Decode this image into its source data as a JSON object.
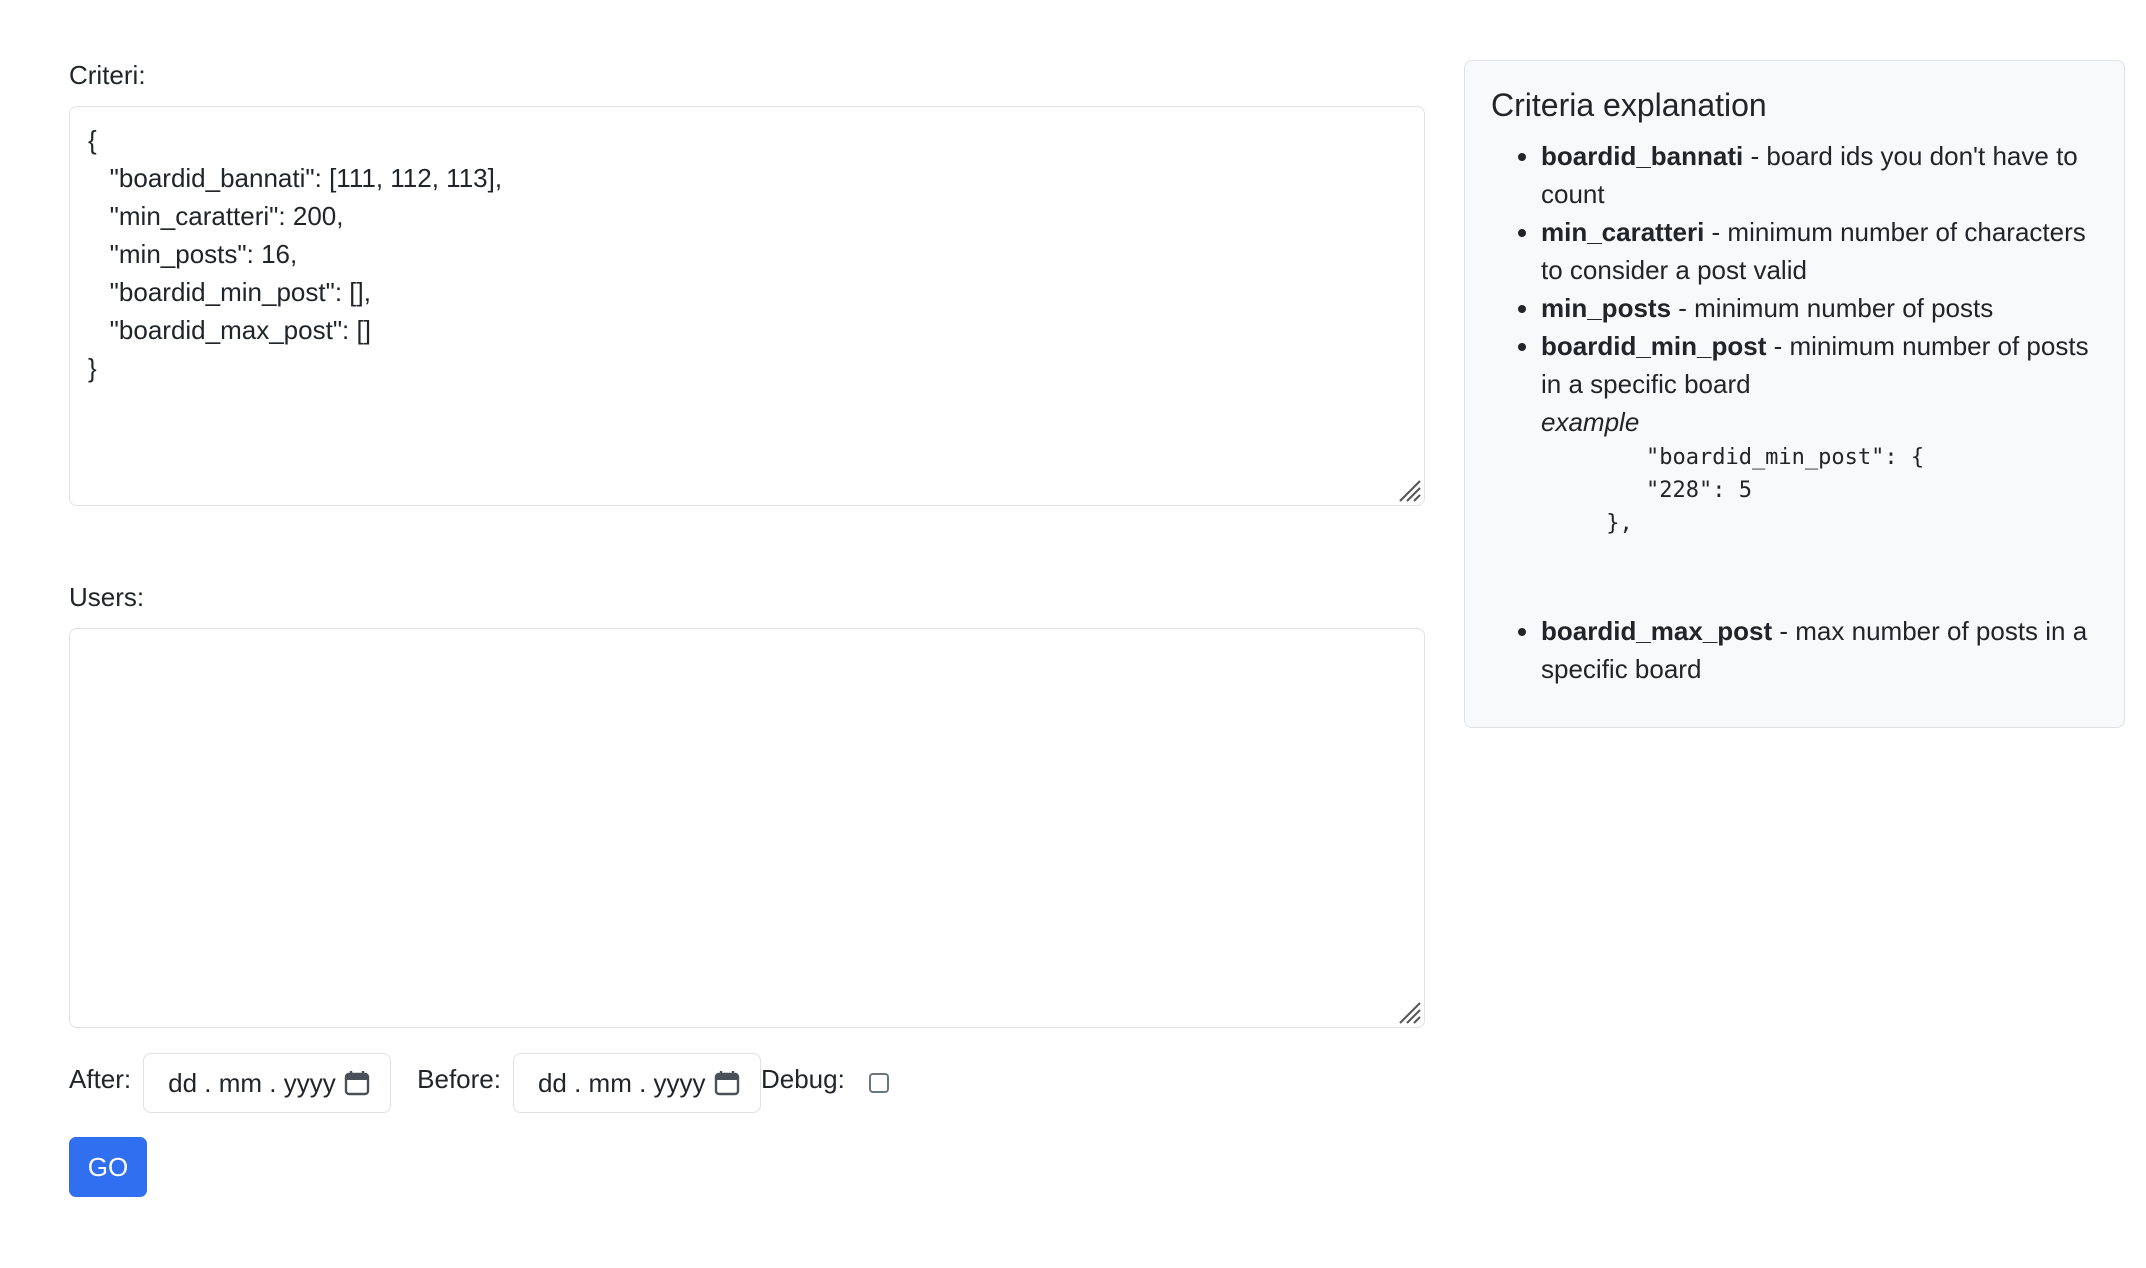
{
  "form": {
    "criteria_label": "Criteri:",
    "criteria_value": "{\n   \"boardid_bannati\": [111, 112, 113],\n   \"min_caratteri\": 200,\n   \"min_posts\": 16,\n   \"boardid_min_post\": [],\n   \"boardid_max_post\": []\n}",
    "users_label": "Users:",
    "users_value": "",
    "after_label": "After:",
    "after_placeholder": "dd . mm . yyyy",
    "before_label": "Before:",
    "before_placeholder": "dd . mm . yyyy",
    "debug_label": "Debug:",
    "debug_checked": false,
    "go_label": "GO"
  },
  "explanation": {
    "title": "Criteria explanation",
    "items": [
      {
        "key": "boardid_bannati",
        "desc": " - board ids you don't have to count"
      },
      {
        "key": "min_caratteri",
        "desc": " - minimum number of characters to consider a post valid"
      },
      {
        "key": "min_posts",
        "desc": " - minimum number of posts"
      },
      {
        "key": "boardid_min_post",
        "desc": " - minimum number of posts in a specific board"
      },
      {
        "key": "boardid_max_post",
        "desc": " - max number of posts in a specific board"
      }
    ],
    "example_label": "example",
    "example_code": "    \"boardid_min_post\": {\n    \"228\": 5\n },"
  },
  "icons": {
    "calendar": "calendar-icon",
    "resize": "resize-grip-icon"
  }
}
